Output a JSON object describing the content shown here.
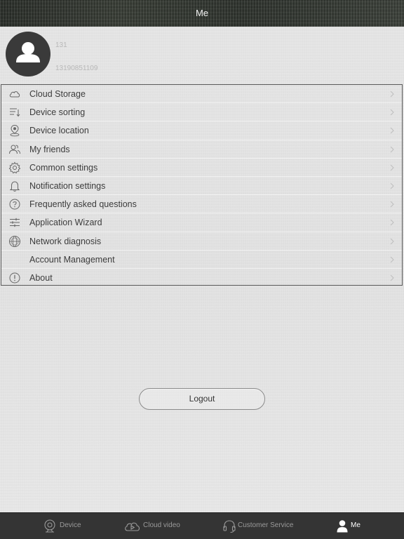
{
  "header": {
    "title": "Me"
  },
  "profile": {
    "name": "131",
    "phone": "13190851109",
    "avatar_icon": "user-silhouette-icon"
  },
  "menu": {
    "items": [
      {
        "label": "Cloud Storage",
        "icon": "cloud-icon"
      },
      {
        "label": "Device sorting",
        "icon": "sort-icon"
      },
      {
        "label": "Device location",
        "icon": "location-pin-icon"
      },
      {
        "label": "My friends",
        "icon": "friends-icon"
      },
      {
        "label": "Common settings",
        "icon": "gear-icon"
      },
      {
        "label": "Notification settings",
        "icon": "bell-icon"
      },
      {
        "label": "Frequently asked questions",
        "icon": "question-icon"
      },
      {
        "label": "Application Wizard",
        "icon": "sliders-icon"
      },
      {
        "label": "Network diagnosis",
        "icon": "globe-icon"
      },
      {
        "label": "Account Management",
        "icon": ""
      },
      {
        "label": "About",
        "icon": "info-icon"
      }
    ]
  },
  "logout": {
    "label": "Logout"
  },
  "tabbar": {
    "tabs": [
      {
        "label": "Device",
        "icon": "camera-icon",
        "active": false
      },
      {
        "label": "Cloud video",
        "icon": "cloud-play-icon",
        "active": false
      },
      {
        "label": "Customer Service",
        "icon": "headset-icon",
        "active": false
      },
      {
        "label": "Me",
        "icon": "person-icon",
        "active": true
      }
    ]
  },
  "colors": {
    "header_bg": "#2f342e",
    "tabbar_bg": "#343434",
    "text": "#3c3c3c",
    "active_tab": "#ffffff",
    "inactive_tab": "#9a9a9a"
  }
}
